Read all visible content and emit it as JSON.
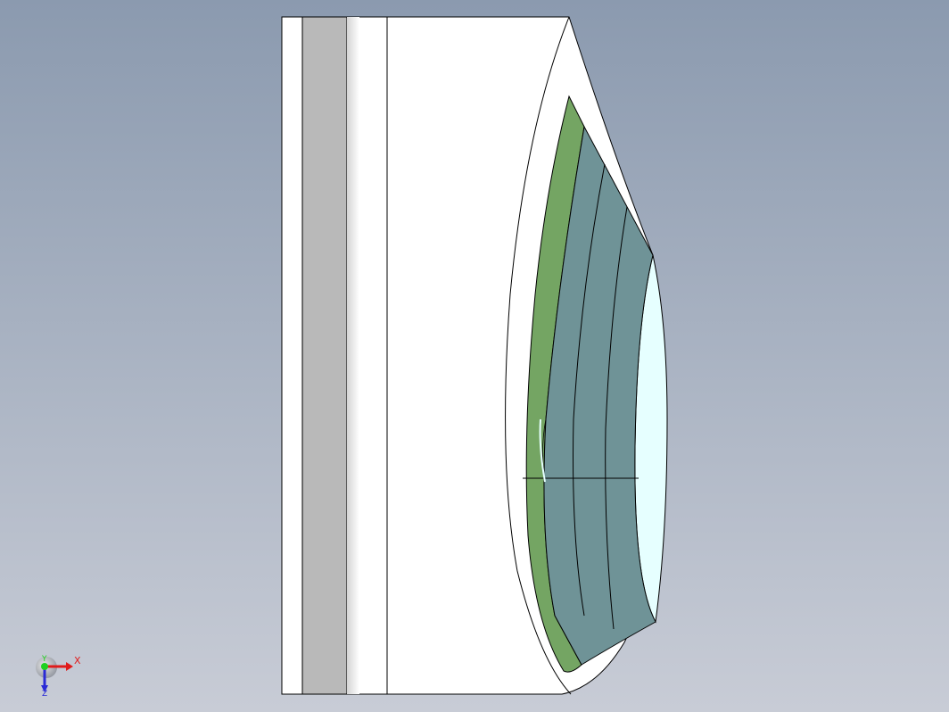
{
  "viewport": {
    "background_top": "#8b9aaf",
    "background_bottom": "#c8ccd6"
  },
  "model": {
    "edge_color": "#000000",
    "face_white": "#ffffff",
    "band_gray": "#b9b9b9",
    "shade_gray": "#e2e2e2",
    "ring_green": "#74a563",
    "cone_teal": "#6f9397",
    "cone_teal_light": "#7ea0a3",
    "inner_cyan": "#e6ffff"
  },
  "triad": {
    "x_label": "X",
    "y_label": "Y",
    "z_label": "Z",
    "x_color": "#e01b1b",
    "y_color": "#1fd11f",
    "z_color": "#2a2ad6"
  }
}
